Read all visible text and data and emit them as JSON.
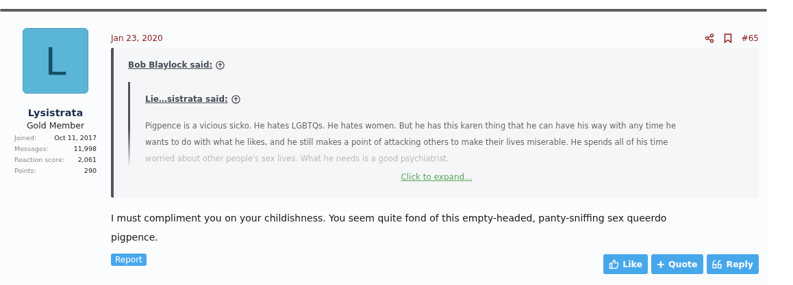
{
  "user": {
    "initial": "L",
    "name": "Lysistrata",
    "title": "Gold Member",
    "stats": [
      {
        "label": "Joined:",
        "value": "Oct 11, 2017"
      },
      {
        "label": "Messages:",
        "value": "11,998"
      },
      {
        "label": "Reaction score:",
        "value": "2,061"
      },
      {
        "label": "Points:",
        "value": "290"
      }
    ]
  },
  "post": {
    "date": "Jan 23, 2020",
    "number": "#65",
    "quote": {
      "author": "Bob Blaylock said:",
      "inner_quote": {
        "author": "Lie…sistrata said:",
        "lines": [
          "Pigpence is a vicious sicko. He hates LGBTQs. He hates women. But he has this karen thing that he can have his way with any time he",
          "wants to do with what he likes, and he still makes a point of attacking others to make their lives miserable. He spends all of his time",
          "worried about other people's sex lives. What he needs is a good psychiatrist."
        ]
      },
      "expand": "Click to expand..."
    },
    "body": "I must compliment you on your childishness. You seem quite fond of this empty-headed, panty-sniffing sex queerdo pigpence.",
    "report": "Report",
    "actions": [
      {
        "kind": "like",
        "label": "Like"
      },
      {
        "kind": "quote",
        "label": "Quote"
      },
      {
        "kind": "reply",
        "label": "Reply"
      }
    ]
  }
}
